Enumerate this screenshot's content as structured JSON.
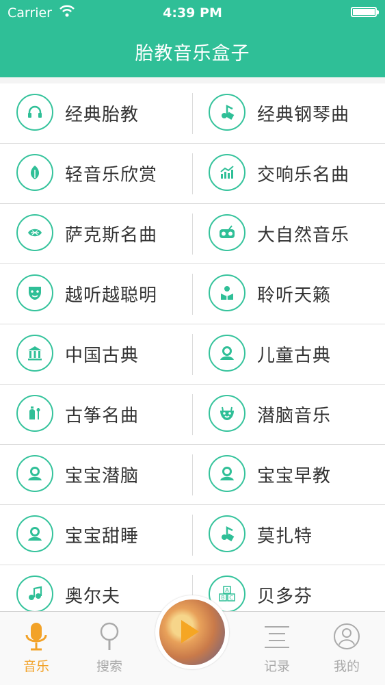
{
  "status": {
    "carrier": "Carrier",
    "time": "4:39 PM"
  },
  "header": {
    "title": "胎教音乐盒子"
  },
  "accent": "#2fbf97",
  "categories": [
    {
      "label": "经典胎教",
      "icon": "headphones-icon"
    },
    {
      "label": "经典钢琴曲",
      "icon": "piano-note-icon"
    },
    {
      "label": "轻音乐欣赏",
      "icon": "leaf-icon"
    },
    {
      "label": "交响乐名曲",
      "icon": "chart-icon"
    },
    {
      "label": "萨克斯名曲",
      "icon": "fan-icon"
    },
    {
      "label": "大自然音乐",
      "icon": "radio-icon"
    },
    {
      "label": "越听越聪明",
      "icon": "mask-icon"
    },
    {
      "label": "聆听天籁",
      "icon": "reading-child-icon"
    },
    {
      "label": "中国古典",
      "icon": "temple-icon"
    },
    {
      "label": "儿童古典",
      "icon": "baby-icon"
    },
    {
      "label": "古筝名曲",
      "icon": "bell-icon"
    },
    {
      "label": "潜脑音乐",
      "icon": "smile-icon"
    },
    {
      "label": "宝宝潜脑",
      "icon": "baby-icon"
    },
    {
      "label": "宝宝早教",
      "icon": "baby-icon"
    },
    {
      "label": "宝宝甜睡",
      "icon": "baby-icon"
    },
    {
      "label": "莫扎特",
      "icon": "piano-note-icon"
    },
    {
      "label": "奥尔夫",
      "icon": "music-note-icon"
    },
    {
      "label": "贝多芬",
      "icon": "abc-blocks-icon"
    }
  ],
  "tabs": {
    "music": "音乐",
    "search": "搜索",
    "history": "记录",
    "mine": "我的"
  },
  "tab_colors": {
    "active": "#f2a228",
    "inactive": "#aaaaaa"
  }
}
